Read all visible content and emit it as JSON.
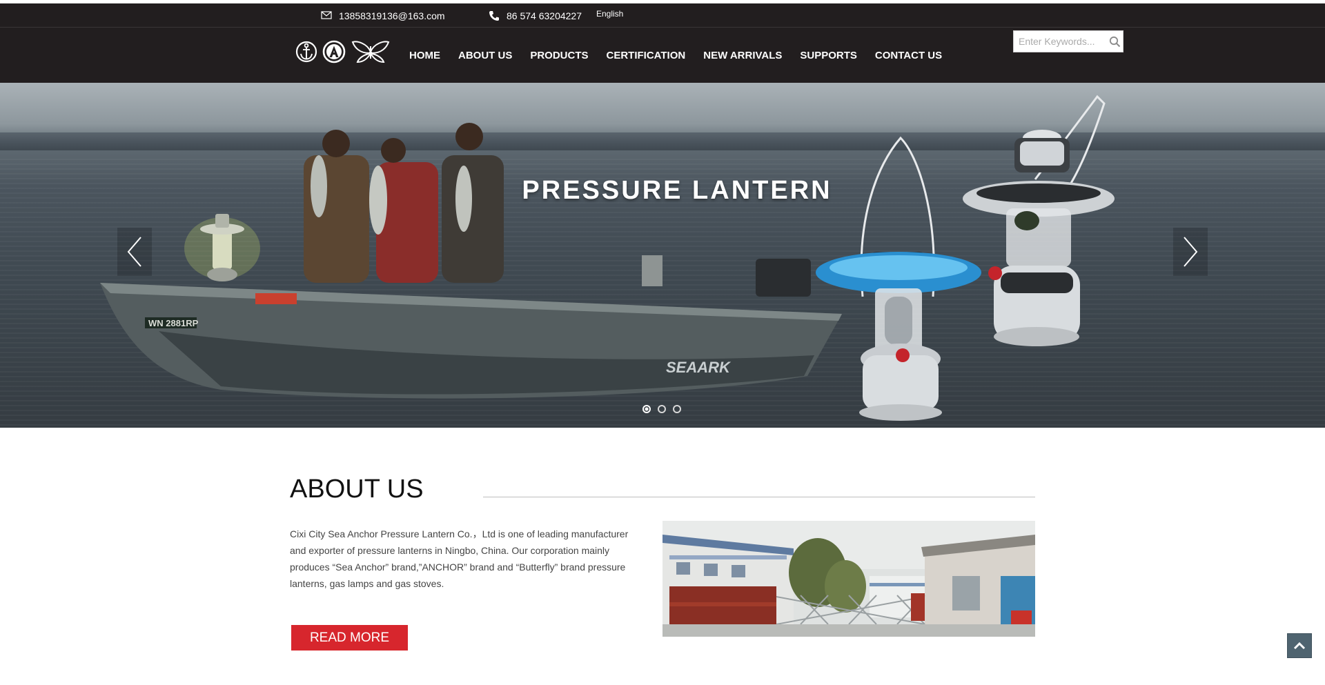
{
  "topbar": {
    "email": "13858319136@163.com",
    "phone": "86 574 63204227",
    "language": "English",
    "email_icon": "envelope-icon",
    "phone_icon": "phone-icon"
  },
  "header": {
    "logo_icons": [
      "anchor-icon",
      "circled-a-icon",
      "butterfly-icon"
    ],
    "nav": {
      "home": "HOME",
      "about": "ABOUT US",
      "products": "PRODUCTS",
      "certification": "CERTIFICATION",
      "new_arrivals": "NEW ARRIVALS",
      "supports": "SUPPORTS",
      "contact": "CONTACT US"
    },
    "search": {
      "placeholder": "Enter Keywords...",
      "icon": "search-icon"
    }
  },
  "hero": {
    "title": "PRESSURE LANTERN",
    "boat_registration": "WN 2881RP",
    "boat_brand": "SEAARK",
    "slide_count": 3,
    "active_slide": 1
  },
  "about": {
    "title": "ABOUT US",
    "text": "Cixi City Sea Anchor Pressure Lantern Co.，Ltd is one of leading manufacturer and exporter of pressure lanterns in Ningbo, China. Our corporation mainly produces “Sea Anchor” brand,”ANCHOR” brand and “Butterfly” brand pressure lanterns, gas lamps and gas stoves.",
    "read_more": "READ MORE"
  },
  "colors": {
    "header_bg": "#221e1f",
    "accent_red": "#d7262d",
    "backtop_bg": "#4f6470"
  }
}
